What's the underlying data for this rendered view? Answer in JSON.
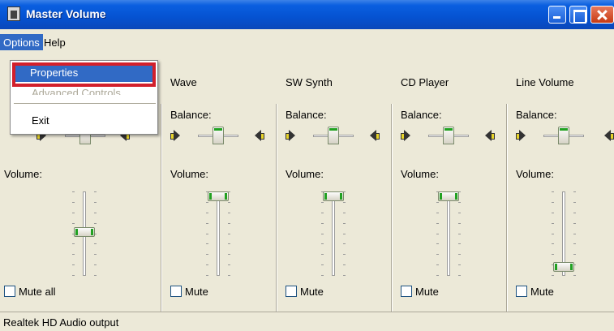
{
  "window": {
    "title": "Master Volume",
    "icon": "mixer-app-icon"
  },
  "menu": {
    "items": [
      {
        "label": "Options"
      },
      {
        "label": "Help"
      }
    ],
    "dropdown": {
      "properties": "Properties",
      "advanced": "Advanced Controls",
      "exit": "Exit"
    }
  },
  "channels": [
    {
      "name": "",
      "balance": "",
      "volume": "Volume:",
      "mute": "Mute all",
      "volume_level": 0.5,
      "balance_level": 0.5
    },
    {
      "name": "Wave",
      "balance": "Balance:",
      "volume": "Volume:",
      "mute": "Mute",
      "volume_level": 1.0,
      "balance_level": 0.5
    },
    {
      "name": "SW Synth",
      "balance": "Balance:",
      "volume": "Volume:",
      "mute": "Mute",
      "volume_level": 1.0,
      "balance_level": 0.5
    },
    {
      "name": "CD Player",
      "balance": "Balance:",
      "volume": "Volume:",
      "mute": "Mute",
      "volume_level": 1.0,
      "balance_level": 0.5
    },
    {
      "name": "Line Volume",
      "balance": "Balance:",
      "volume": "Volume:",
      "mute": "Mute",
      "volume_level": 0.0,
      "balance_level": 0.5
    }
  ],
  "status": {
    "text": "Realtek HD Audio output"
  },
  "colors": {
    "titlebar": "#0552d1",
    "selection": "#316ac5",
    "highlight_box": "#d2202c",
    "slider_accent": "#21a121"
  }
}
